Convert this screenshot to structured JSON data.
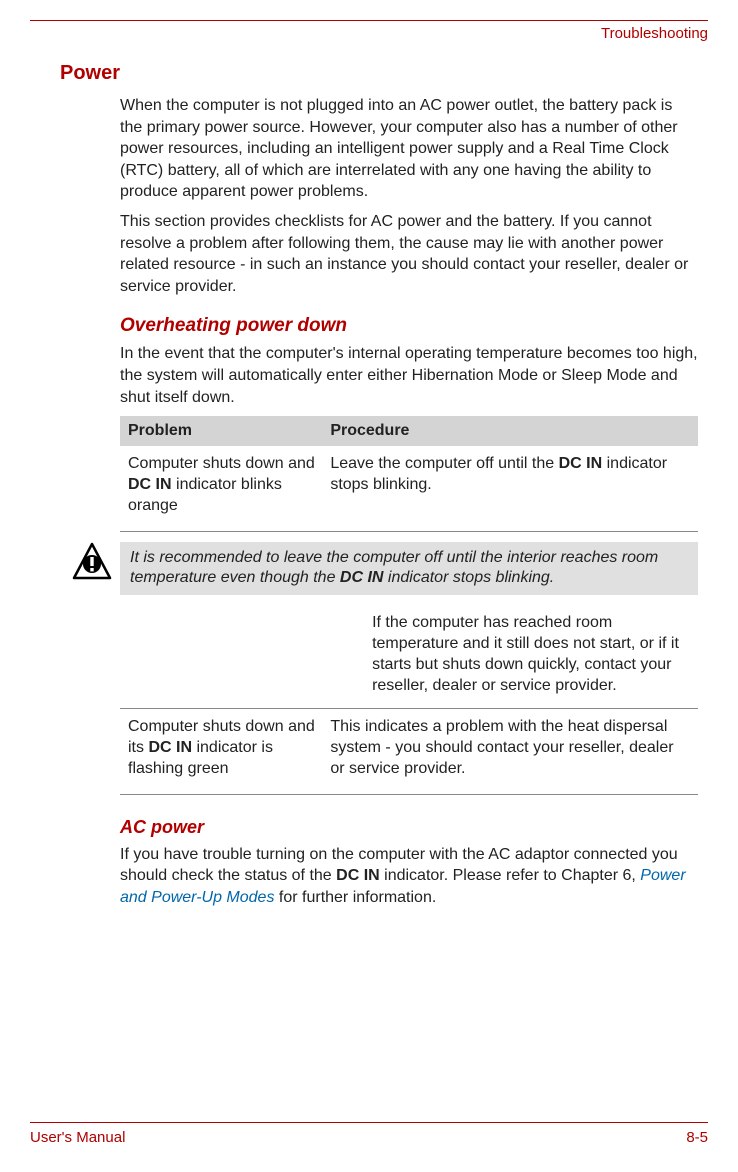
{
  "header": {
    "breadcrumb": "Troubleshooting"
  },
  "sections": {
    "power": {
      "title": "Power",
      "p1": "When the computer is not plugged into an AC power outlet, the battery pack is the primary power source. However, your computer also has a number of other power resources, including an intelligent power supply and a Real Time Clock (RTC) battery, all of which are interrelated with any one having the ability to produce apparent power problems.",
      "p2": "This section provides checklists for AC power and the battery. If you cannot resolve a problem after following them, the cause may lie with another power related resource - in such an instance you should contact your reseller, dealer or service provider."
    },
    "overheating": {
      "title": "Overheating power down",
      "intro": "In the event that the computer's internal operating temperature becomes too high, the system will automatically enter either Hibernation Mode or Sleep Mode and shut itself down.",
      "table": {
        "head": {
          "c1": "Problem",
          "c2": "Procedure"
        },
        "row1": {
          "c1_a": "Computer shuts down and ",
          "c1_b": "DC IN",
          "c1_c": " indicator blinks orange",
          "c2_a": "Leave the computer off until the ",
          "c2_b": "DC IN",
          "c2_c": " indicator stops blinking."
        },
        "note": {
          "a": "It is recommended to leave the computer off until the interior reaches room temperature even though the ",
          "b": "DC IN",
          "c": " indicator stops blinking."
        },
        "row1_cont": "If the computer has reached room temperature and it still does not start, or if it starts but shuts down quickly, contact your reseller, dealer or service provider.",
        "row2": {
          "c1_a": "Computer shuts down and its ",
          "c1_b": "DC IN",
          "c1_c": " indicator is flashing green",
          "c2": "This indicates a problem with the heat dispersal system - you should contact your reseller, dealer or service provider."
        }
      }
    },
    "acpower": {
      "title": "AC power",
      "p_a": "If you have trouble turning on the computer with the AC adaptor connected you should check the status of the ",
      "p_b": "DC IN",
      "p_c": " indicator. Please refer to Chapter 6, ",
      "p_link": "Power and Power-Up Modes",
      "p_d": " for further information."
    }
  },
  "footer": {
    "left": "User's Manual",
    "right": "8-5"
  }
}
